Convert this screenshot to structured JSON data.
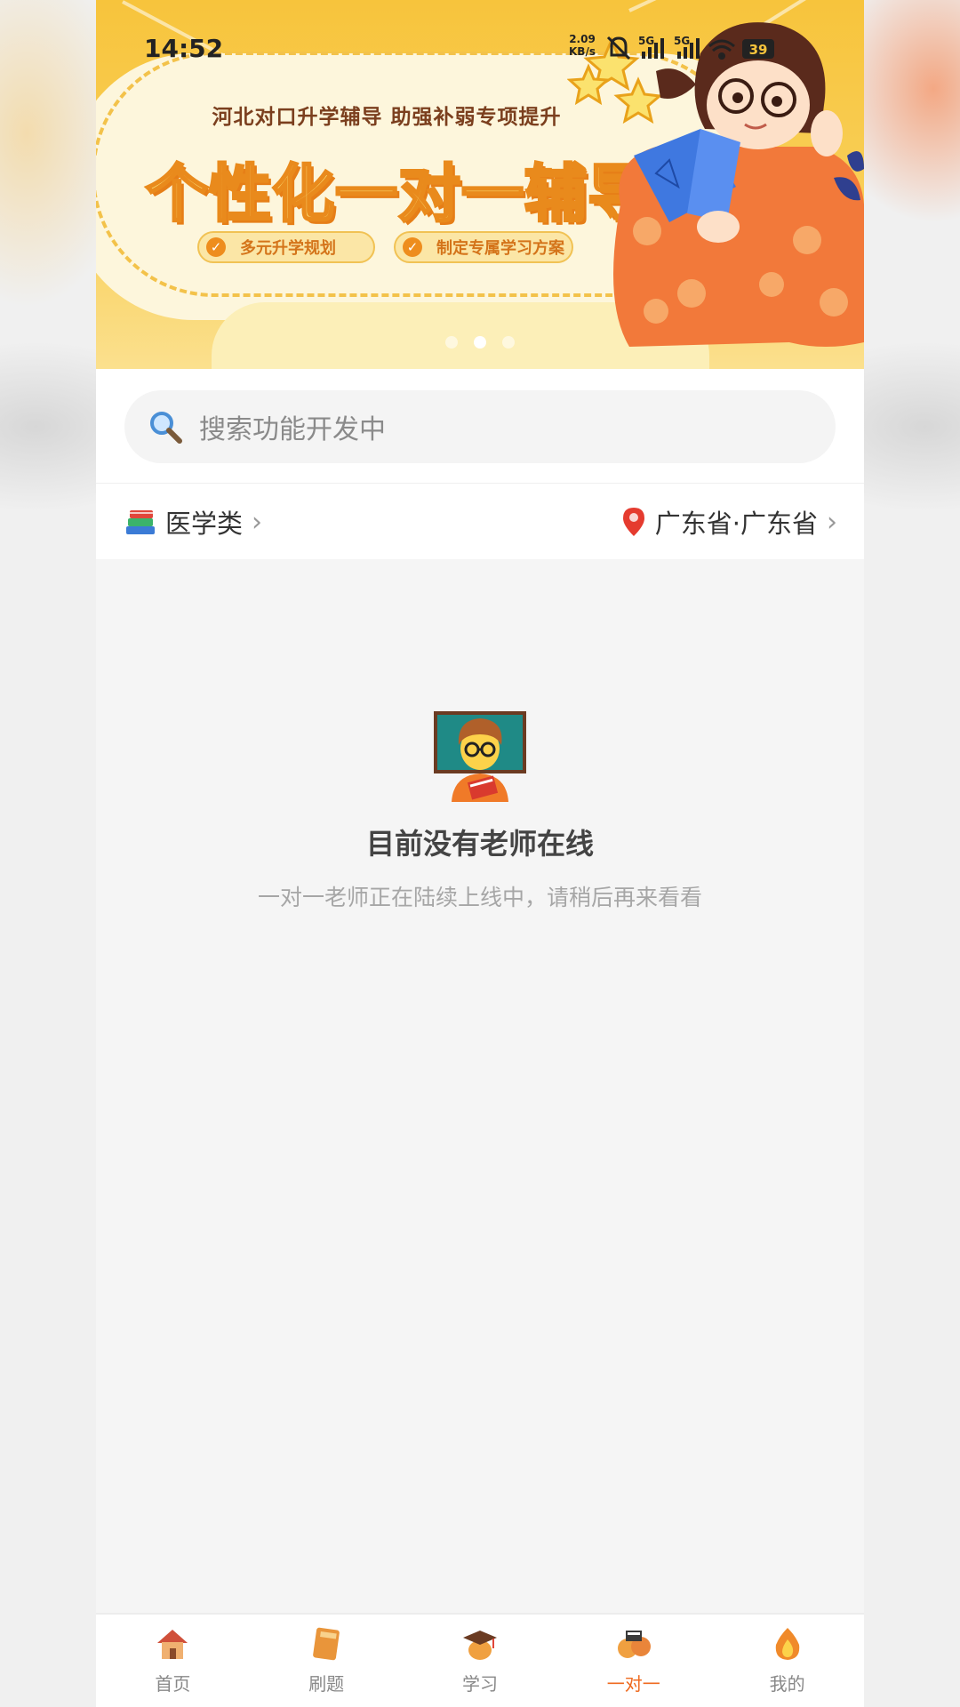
{
  "status_bar": {
    "time": "14:52",
    "net_speed_value": "2.09",
    "net_speed_unit": "KB/s",
    "network_1": "5G",
    "network_2": "5G",
    "battery": "39"
  },
  "banner": {
    "subtitle": "河北对口升学辅导  助强补弱专项提升",
    "title": "个性化一对一辅导",
    "tags": [
      "多元升学规划",
      "制定专属学习方案"
    ],
    "carousel_active_index": 1,
    "carousel_count": 3
  },
  "search": {
    "placeholder": "搜索功能开发中",
    "icon": "search-icon"
  },
  "filters": {
    "category": "医学类",
    "category_icon": "books-icon",
    "location": "广东省·广东省",
    "location_icon": "pin-icon"
  },
  "empty_state": {
    "icon": "teacher-icon",
    "title": "目前没有老师在线",
    "subtitle": "一对一老师正在陆续上线中，请稍后再来看看"
  },
  "tabbar": {
    "items": [
      {
        "label": "首页",
        "icon": "home-icon"
      },
      {
        "label": "刷题",
        "icon": "notebook-icon"
      },
      {
        "label": "学习",
        "icon": "graduation-cap-icon"
      },
      {
        "label": "一对一",
        "icon": "one-on-one-icon",
        "active": true
      },
      {
        "label": "我的",
        "icon": "profile-flame-icon"
      }
    ],
    "active_color": "#ef6a1f"
  },
  "colors": {
    "banner_yellow": "#f7c43c",
    "accent_orange": "#ef6a1f",
    "page_bg": "#f5f5f5"
  }
}
